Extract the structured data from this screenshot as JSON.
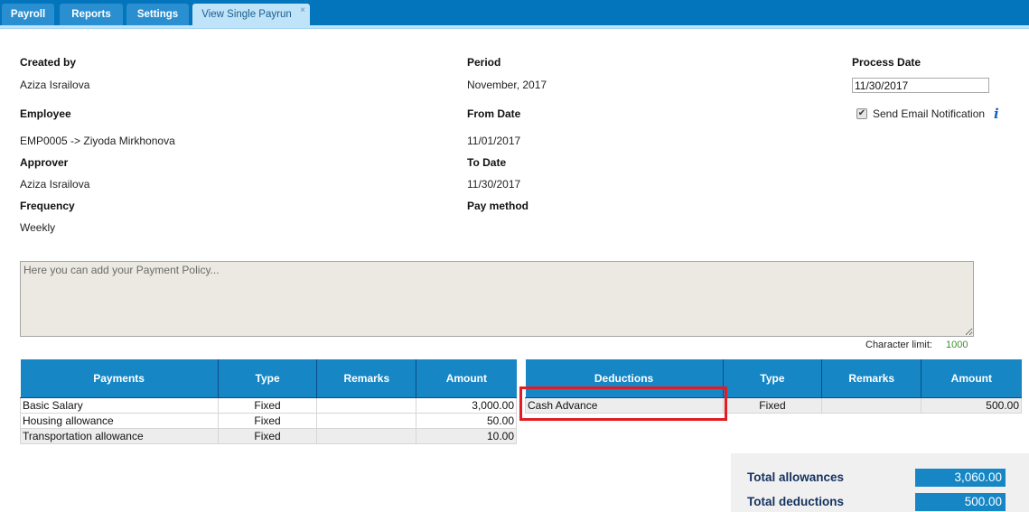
{
  "tabs": [
    {
      "label": "Payroll",
      "active": false
    },
    {
      "label": "Reports",
      "active": false
    },
    {
      "label": "Settings",
      "active": false
    },
    {
      "label": "View Single Payrun",
      "active": true,
      "closable": true
    }
  ],
  "tab_close_glyph": "×",
  "info": {
    "created_by_label": "Created by",
    "created_by": "Aziza Israilova",
    "employee_label": "Employee",
    "employee": "EMP0005 -> Ziyoda Mirkhonova",
    "approver_label": "Approver",
    "approver": "Aziza Israilova",
    "frequency_label": "Frequency",
    "frequency": "Weekly",
    "period_label": "Period",
    "period": "November, 2017",
    "from_date_label": "From Date",
    "from_date": "11/01/2017",
    "to_date_label": "To Date",
    "to_date": "11/30/2017",
    "pay_method_label": "Pay method",
    "process_date_label": "Process Date",
    "process_date": "11/30/2017",
    "send_email_label": "Send Email Notification",
    "send_email_checked": true,
    "info_icon": "i"
  },
  "policy": {
    "placeholder": "Here you can add your Payment Policy...",
    "char_limit_label": "Character limit:",
    "char_limit": "1000"
  },
  "payments": {
    "headers": [
      "Payments",
      "Type",
      "Remarks",
      "Amount"
    ],
    "rows": [
      {
        "name": "Basic Salary",
        "type": "Fixed",
        "remarks": "",
        "amount": "3,000.00"
      },
      {
        "name": "Housing allowance",
        "type": "Fixed",
        "remarks": "",
        "amount": "50.00"
      },
      {
        "name": "Transportation allowance",
        "type": "Fixed",
        "remarks": "",
        "amount": "10.00"
      }
    ]
  },
  "deductions": {
    "headers": [
      "Deductions",
      "Type",
      "Remarks",
      "Amount"
    ],
    "rows": [
      {
        "name": "Cash Advance",
        "type": "Fixed",
        "remarks": "",
        "amount": "500.00"
      }
    ]
  },
  "totals": {
    "allowances_label": "Total allowances",
    "allowances": "3,060.00",
    "deductions_label": "Total deductions",
    "deductions": "500.00"
  },
  "colors": {
    "topbar": "#0275bd",
    "header_blue": "#1686c5",
    "highlight_red": "#e31b23",
    "char_limit_green": "#3f8f2f"
  }
}
